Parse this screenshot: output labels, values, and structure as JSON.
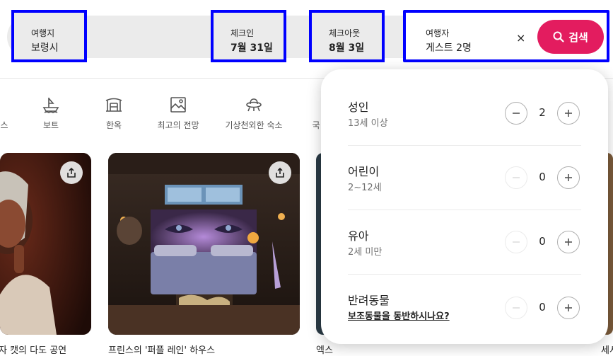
{
  "search": {
    "destination": {
      "label": "여행지",
      "value": "보령시"
    },
    "checkin": {
      "label": "체크인",
      "value": "7월 31일"
    },
    "checkout": {
      "label": "체크아웃",
      "value": "8월 3일"
    },
    "guests": {
      "label": "여행자",
      "value": "게스트 2명"
    },
    "clear_label": "×",
    "search_button_label": "검색",
    "accent_color": "#e31c5f"
  },
  "categories": [
    {
      "label": "스",
      "icon": "partial-icon"
    },
    {
      "label": "보트",
      "icon": "boat-icon"
    },
    {
      "label": "한옥",
      "icon": "hanok-icon"
    },
    {
      "label": "최고의 전망",
      "icon": "view-icon"
    },
    {
      "label": "기상천외한 숙소",
      "icon": "ufo-icon"
    },
    {
      "label": "국",
      "icon": "partial-icon"
    }
  ],
  "cards": [
    {
      "title": "자 캣의 다도 공연"
    },
    {
      "title": "프린스의 '퍼플 레인' 하우스"
    },
    {
      "title": "엑스"
    },
    {
      "title": "세서"
    }
  ],
  "guest_popup": {
    "rows": [
      {
        "title": "성인",
        "subtitle": "13세 이상",
        "count": "2",
        "minus_enabled": true
      },
      {
        "title": "어린이",
        "subtitle": "2~12세",
        "count": "0",
        "minus_enabled": false
      },
      {
        "title": "유아",
        "subtitle": "2세 미만",
        "count": "0",
        "minus_enabled": false
      },
      {
        "title": "반려동물",
        "subtitle": "보조동물을 동반하시나요?",
        "count": "0",
        "minus_enabled": false
      }
    ]
  }
}
